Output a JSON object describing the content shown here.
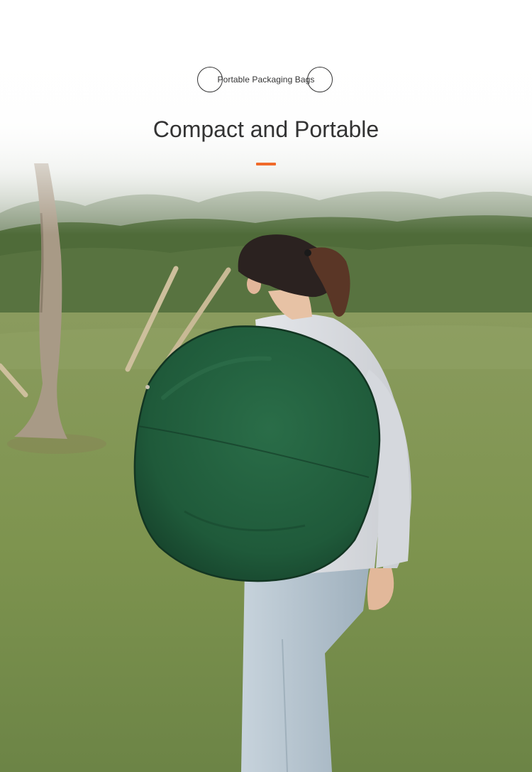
{
  "header": {
    "tagline": "Portable Packaging Bags",
    "headline": "Compact and Portable"
  },
  "colors": {
    "accent": "#f06a2a",
    "text": "#333333",
    "bag": "#1f5a3a",
    "grass": "#7a9150"
  },
  "photo": {
    "subject": "person carrying folded green round pop-up tent bag on back in grassy park"
  }
}
